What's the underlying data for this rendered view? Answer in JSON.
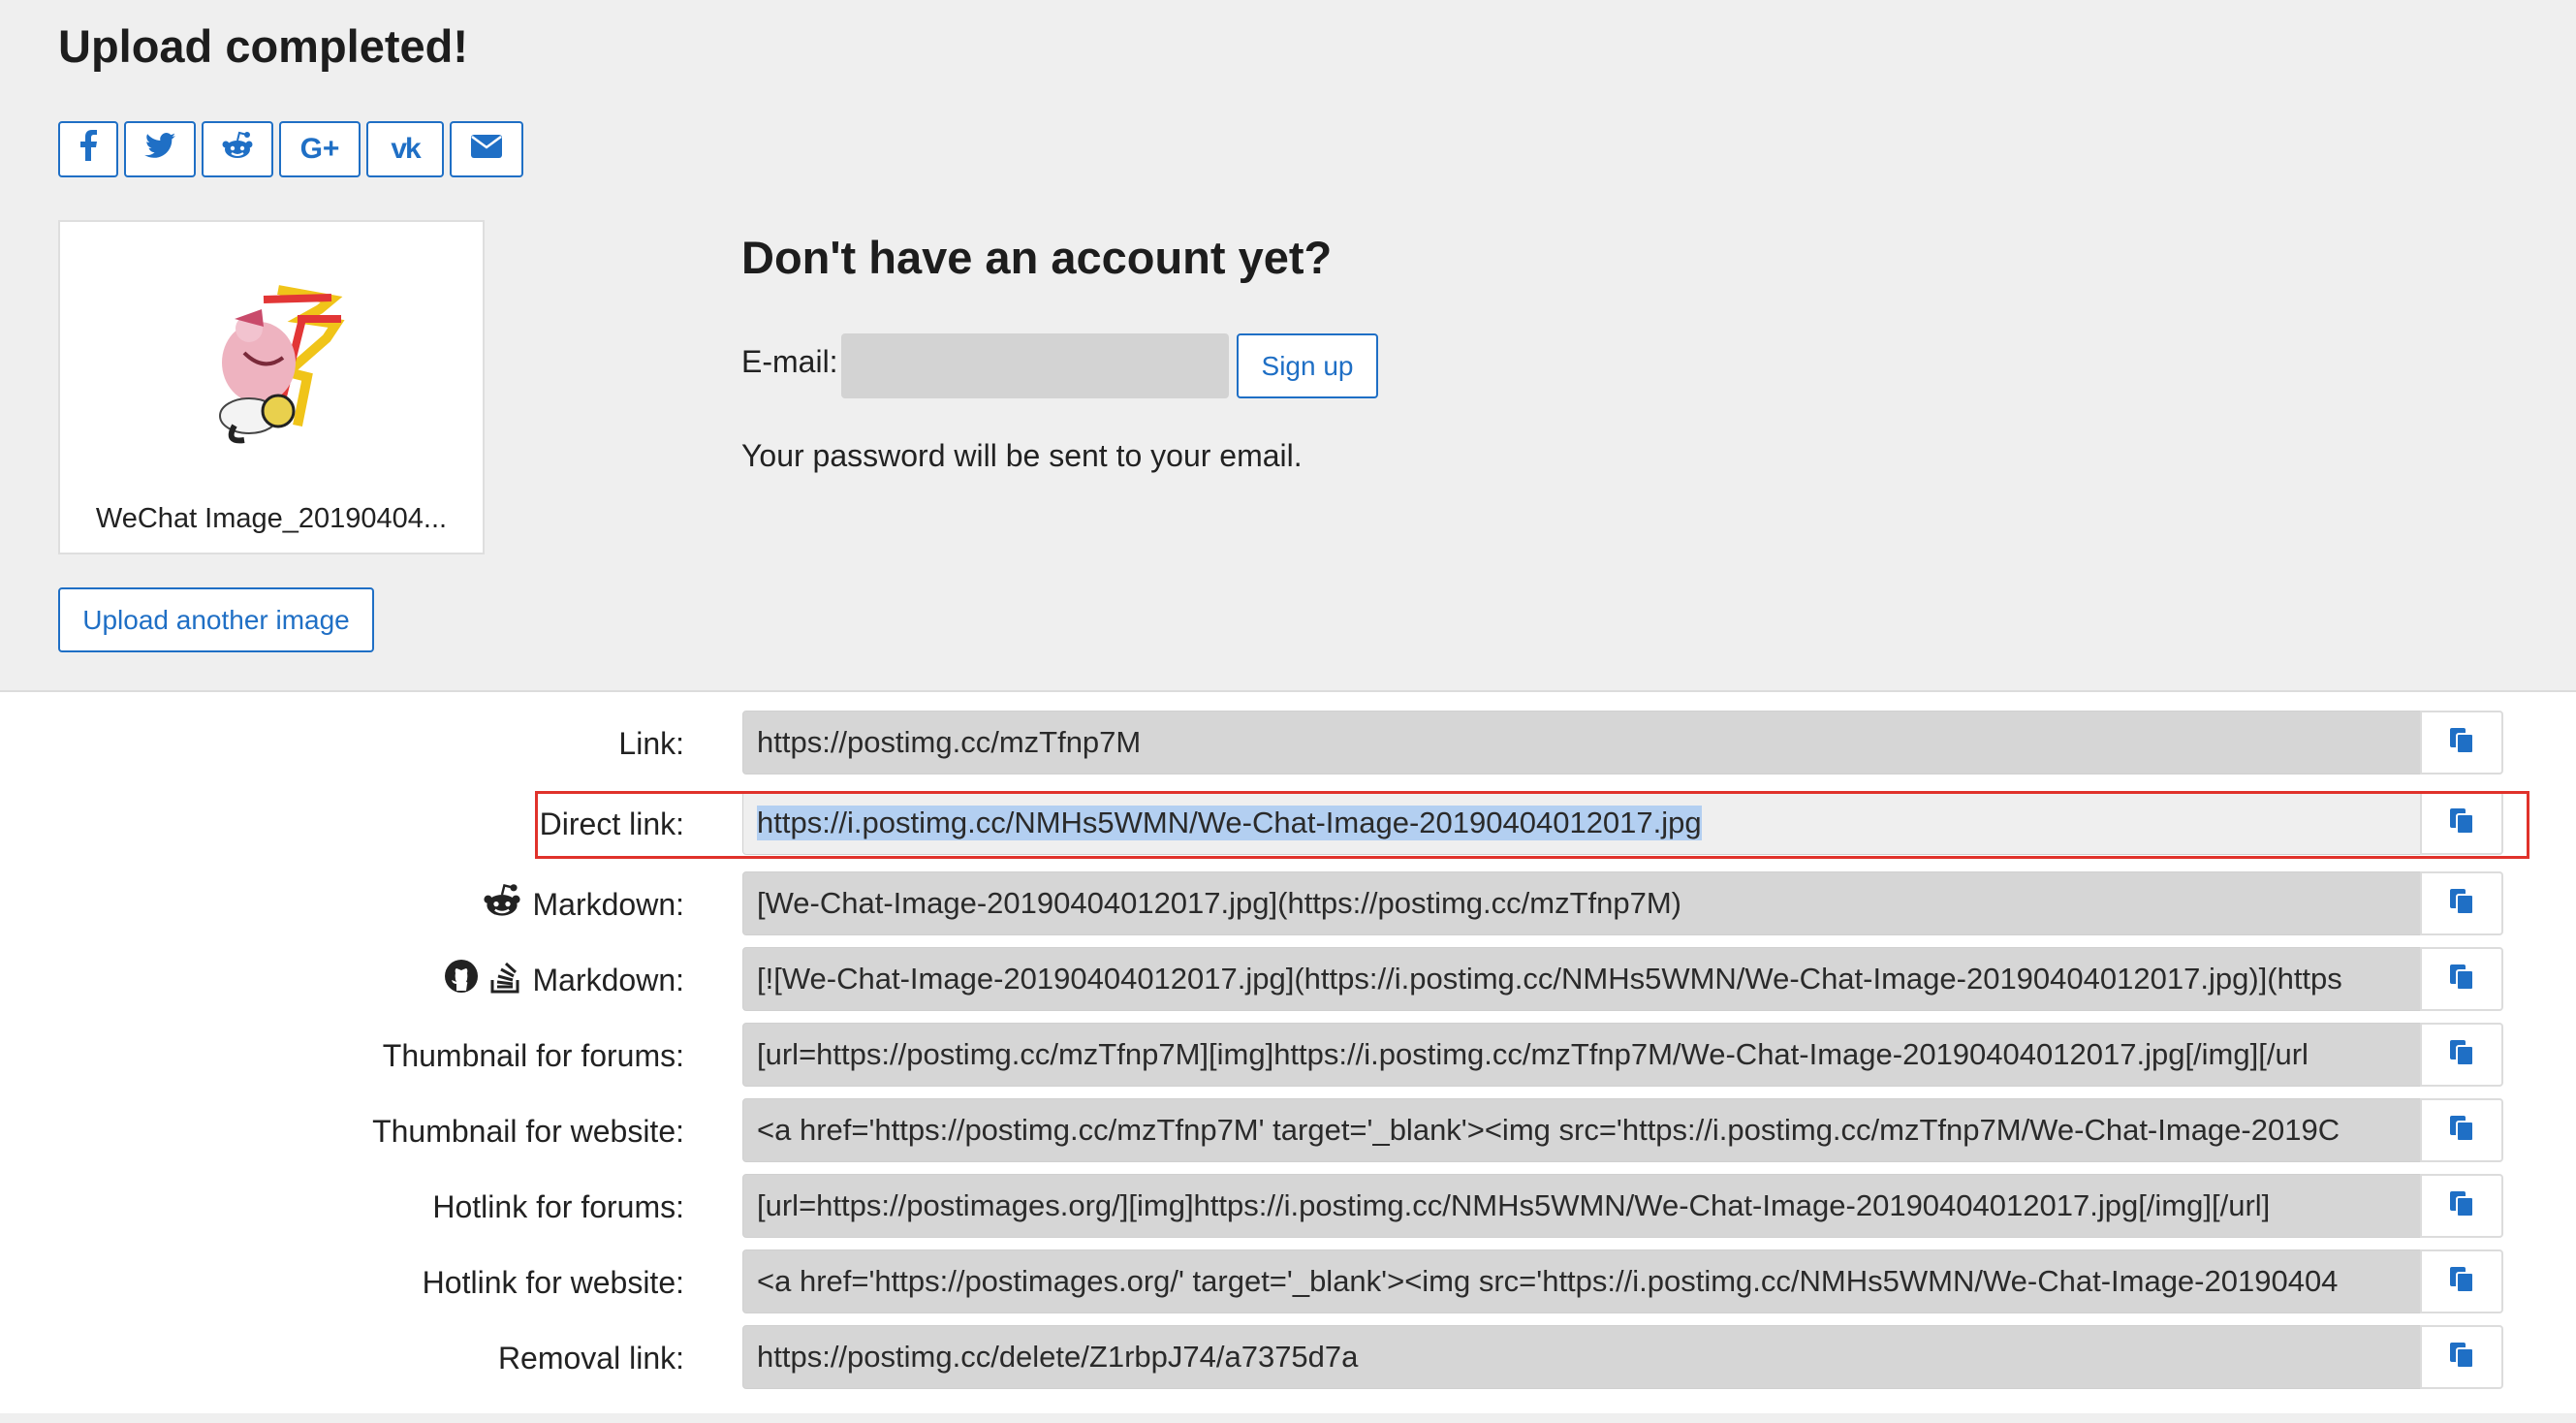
{
  "page": {
    "title": "Upload completed!"
  },
  "share_buttons": [
    {
      "name": "facebook",
      "glyph": "f"
    },
    {
      "name": "twitter",
      "glyph": "t"
    },
    {
      "name": "reddit",
      "glyph": ""
    },
    {
      "name": "google-plus",
      "glyph": "G+"
    },
    {
      "name": "vk",
      "glyph": "vk"
    },
    {
      "name": "email",
      "glyph": ""
    }
  ],
  "thumbnail": {
    "filename": "WeChat Image_20190404..."
  },
  "upload_another_label": "Upload another image",
  "account": {
    "title": "Don't have an account yet?",
    "email_label": "E-mail:",
    "email_value": "",
    "signup_label": "Sign up",
    "note": "Your password will be sent to your email."
  },
  "links": [
    {
      "label": "Link:",
      "value": "https://postimg.cc/mzTfnp7M",
      "icons": []
    },
    {
      "label": "Direct link:",
      "value": "https://i.postimg.cc/NMHs5WMN/We-Chat-Image-20190404012017.jpg",
      "icons": [],
      "selected": true,
      "highlighted": true
    },
    {
      "label": "Markdown:",
      "value": "[We-Chat-Image-20190404012017.jpg](https://postimg.cc/mzTfnp7M)",
      "icons": [
        "reddit-icon"
      ]
    },
    {
      "label": "Markdown:",
      "value": "[![We-Chat-Image-20190404012017.jpg](https://i.postimg.cc/NMHs5WMN/We-Chat-Image-20190404012017.jpg)](https",
      "icons": [
        "github-icon",
        "stackoverflow-icon"
      ]
    },
    {
      "label": "Thumbnail for forums:",
      "value": "[url=https://postimg.cc/mzTfnp7M][img]https://i.postimg.cc/mzTfnp7M/We-Chat-Image-20190404012017.jpg[/img][/url",
      "icons": []
    },
    {
      "label": "Thumbnail for website:",
      "value": "<a href='https://postimg.cc/mzTfnp7M' target='_blank'><img src='https://i.postimg.cc/mzTfnp7M/We-Chat-Image-2019C",
      "icons": []
    },
    {
      "label": "Hotlink for forums:",
      "value": "[url=https://postimages.org/][img]https://i.postimg.cc/NMHs5WMN/We-Chat-Image-20190404012017.jpg[/img][/url]",
      "icons": []
    },
    {
      "label": "Hotlink for website:",
      "value": "<a href='https://postimages.org/' target='_blank'><img src='https://i.postimg.cc/NMHs5WMN/We-Chat-Image-20190404",
      "icons": []
    },
    {
      "label": "Removal link:",
      "value": "https://postimg.cc/delete/Z1rbpJ74/a7375d7a",
      "icons": []
    }
  ],
  "colors": {
    "accent": "#1f6fc5",
    "highlight_box": "#e0322b",
    "selection": "#b3cff1"
  }
}
